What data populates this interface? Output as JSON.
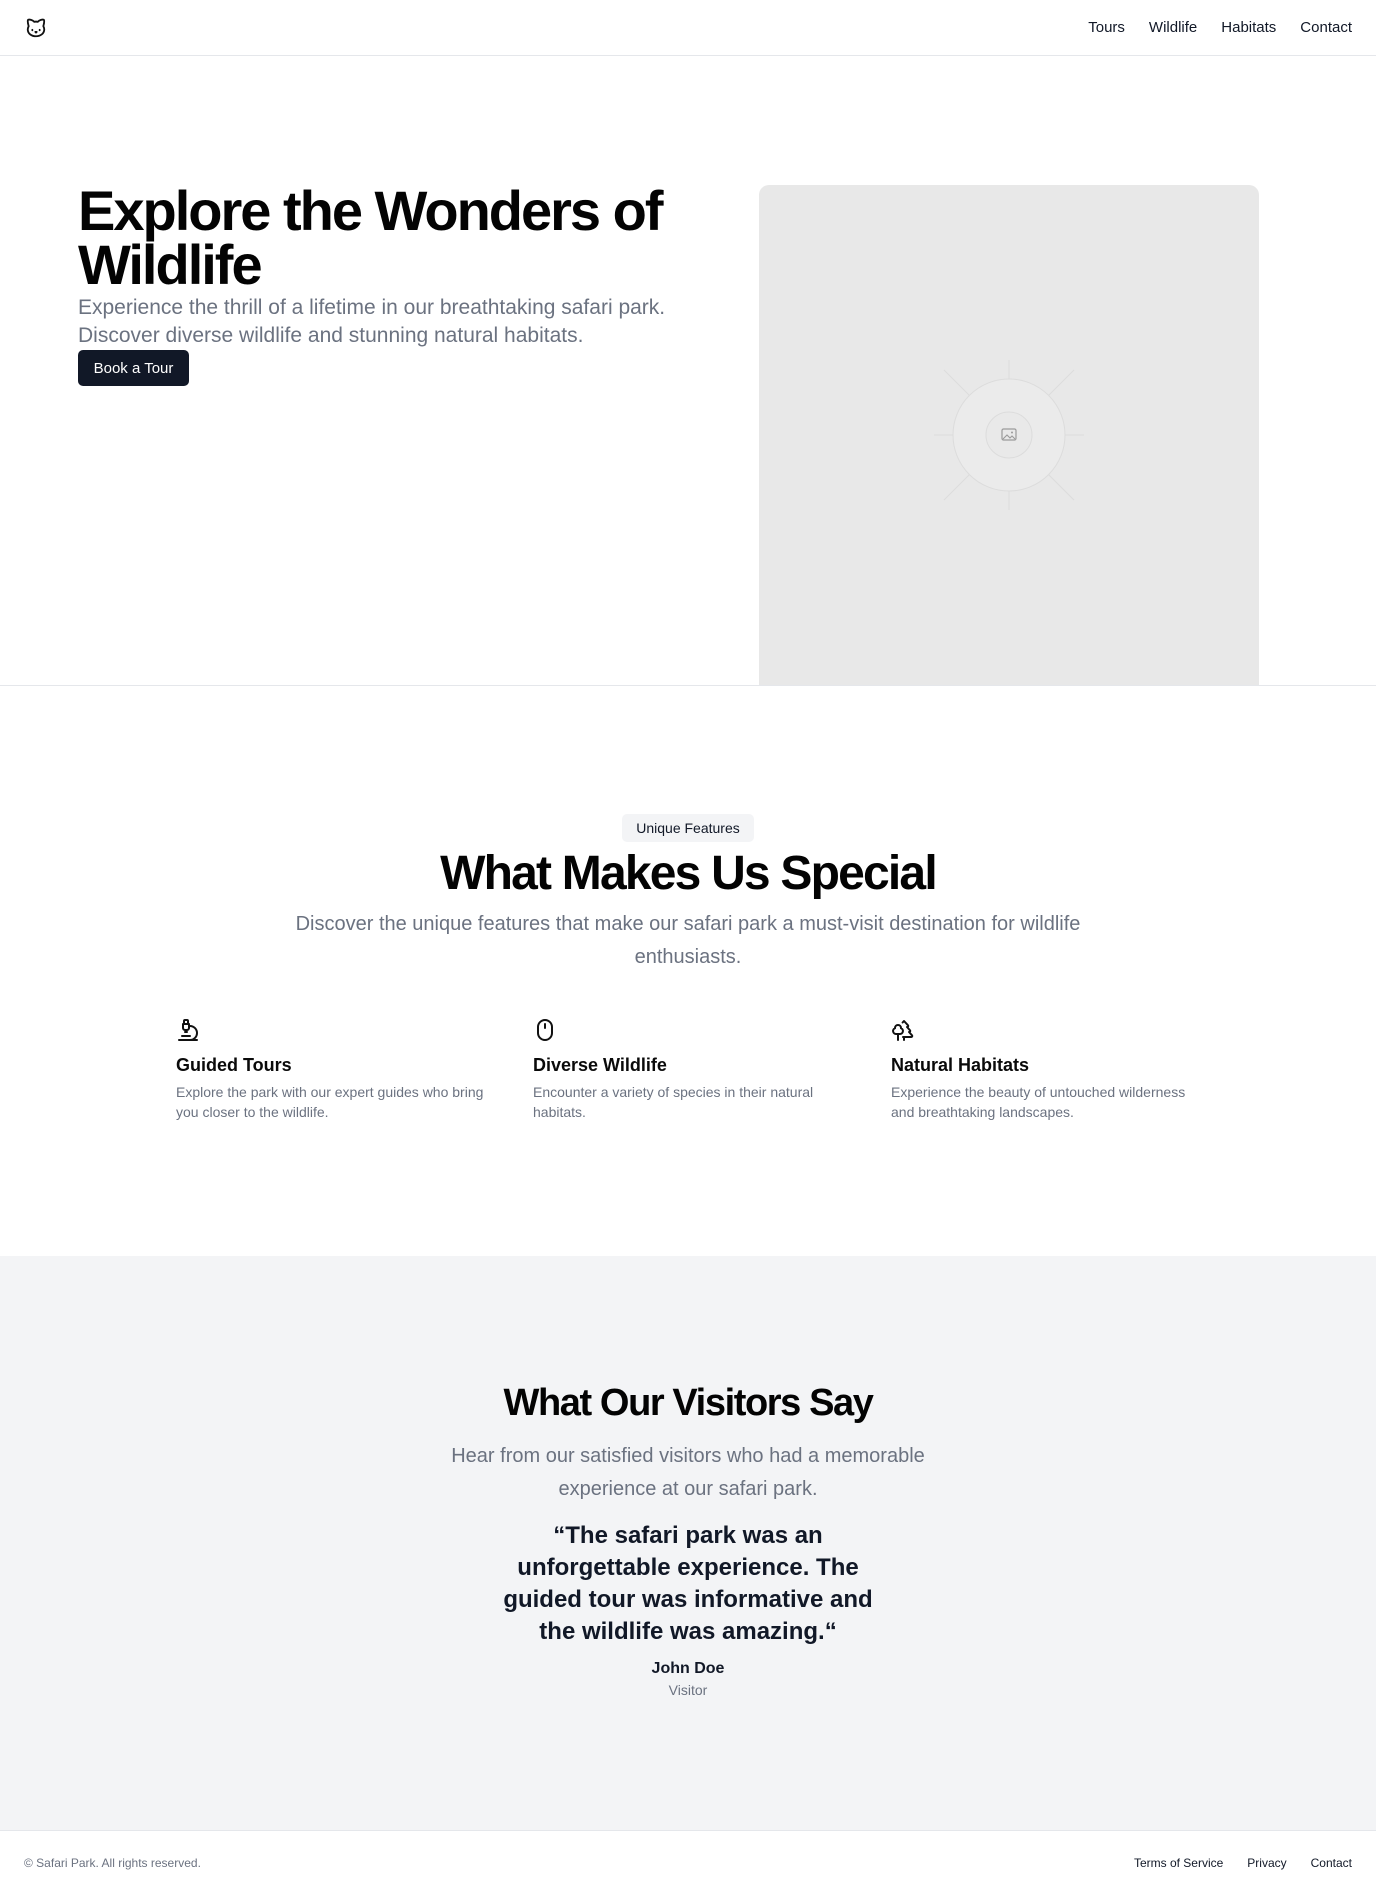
{
  "header": {
    "logo_icon": "cat-icon",
    "nav": [
      {
        "label": "Tours"
      },
      {
        "label": "Wildlife"
      },
      {
        "label": "Habitats"
      },
      {
        "label": "Contact"
      }
    ]
  },
  "hero": {
    "title": "Explore the Wonders of Wildlife",
    "subtitle": "Experience the thrill of a lifetime in our breathtaking safari park. Discover diverse wildlife and stunning natural habitats.",
    "cta_label": "Book a Tour",
    "image_icon": "image-placeholder-icon"
  },
  "features": {
    "badge": "Unique Features",
    "title": "What Makes Us Special",
    "subtitle": "Discover the unique features that make our safari park a must-visit destination for wildlife enthusiasts.",
    "items": [
      {
        "icon": "microscope-icon",
        "title": "Guided Tours",
        "description": "Explore the park with our expert guides who bring you closer to the wildlife."
      },
      {
        "icon": "mouse-icon",
        "title": "Diverse Wildlife",
        "description": "Encounter a variety of species in their natural habitats."
      },
      {
        "icon": "trees-icon",
        "title": "Natural Habitats",
        "description": "Experience the beauty of untouched wilderness and breathtaking landscapes."
      }
    ]
  },
  "testimonials": {
    "title": "What Our Visitors Say",
    "subtitle": "Hear from our satisfied visitors who had a memorable experience at our safari park.",
    "quote": "“The safari park was an unforgettable experience. The guided tour was informative and the wildlife was amazing.“",
    "author": "John Doe",
    "role": "Visitor"
  },
  "footer": {
    "copyright": "© Safari Park. All rights reserved.",
    "links": [
      {
        "label": "Terms of Service"
      },
      {
        "label": "Privacy"
      },
      {
        "label": "Contact"
      }
    ]
  },
  "colors": {
    "primary_button": "#111827",
    "muted_text": "#6b7280",
    "section_bg": "#f3f4f6",
    "image_placeholder": "#e8e8e8"
  }
}
